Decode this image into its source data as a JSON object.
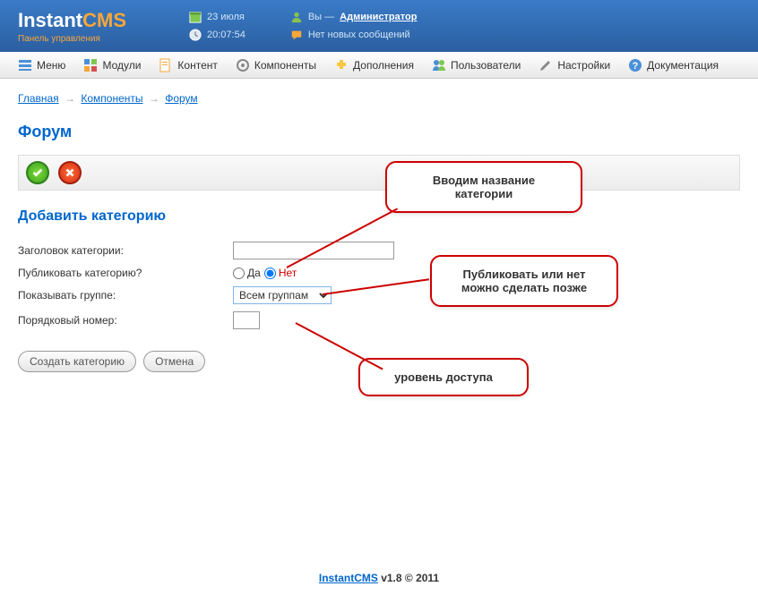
{
  "header": {
    "logo_prefix": "Instant",
    "logo_suffix": "CMS",
    "logo_sub": "Панель управления",
    "date": "23 июля",
    "time": "20:07:54",
    "user_prefix": "Вы —",
    "user_name": "Администратор",
    "messages": "Нет новых сообщений"
  },
  "menu": {
    "items": [
      "Меню",
      "Модули",
      "Контент",
      "Компоненты",
      "Дополнения",
      "Пользователи",
      "Настройки",
      "Документация"
    ]
  },
  "breadcrumb": {
    "items": [
      "Главная",
      "Компоненты",
      "Форум"
    ],
    "sep": "→"
  },
  "page": {
    "title": "Форум",
    "section_title": "Добавить категорию"
  },
  "form": {
    "title_label": "Заголовок категории:",
    "title_value": "",
    "publish_label": "Публиковать категорию?",
    "publish_yes": "Да",
    "publish_no": "Нет",
    "group_label": "Показывать группе:",
    "group_value": "Всем группам",
    "order_label": "Порядковый номер:",
    "order_value": "",
    "submit": "Создать категорию",
    "cancel": "Отмена"
  },
  "callouts": {
    "c1": "Вводим название категории",
    "c2": "Публиковать или нет можно сделать позже",
    "c3": "уровень доступа"
  },
  "footer": {
    "link": "InstantCMS",
    "text": " v1.8 © 2011"
  }
}
